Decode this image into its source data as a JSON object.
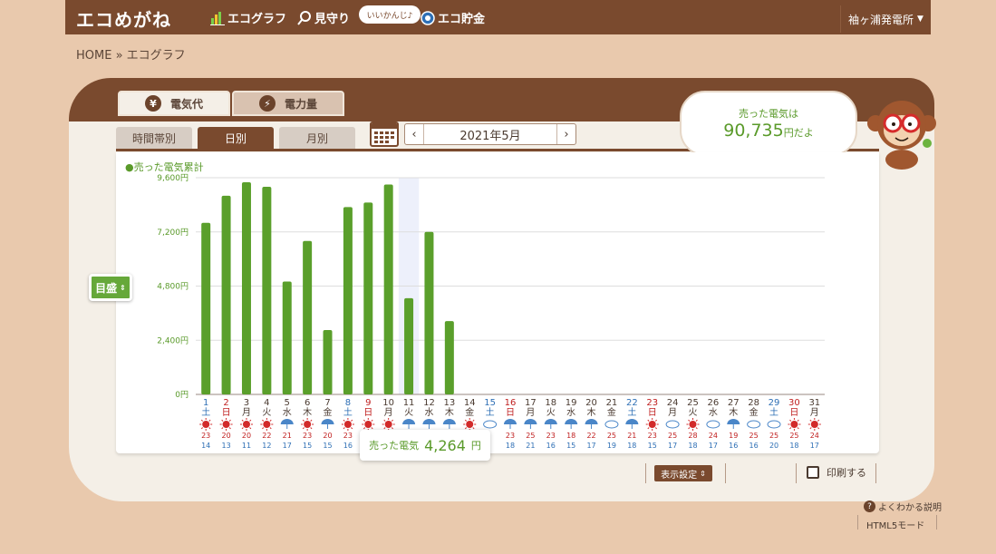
{
  "nav": {
    "logo": "エコめがね",
    "items": [
      {
        "label": "エコグラフ",
        "icon": "bar-chart-icon"
      },
      {
        "label": "見守り",
        "icon": "magnifier-icon"
      },
      {
        "label": "エコ貯金",
        "icon": "coin-icon"
      }
    ],
    "bubble": "いいかんじ♪",
    "site": "袖ヶ浦発電所"
  },
  "breadcrumb": "HOME » エコグラフ",
  "tabs": [
    {
      "label": "電気代",
      "icon": "¥"
    },
    {
      "label": "電力量",
      "icon": "⚡"
    }
  ],
  "subtabs": [
    {
      "label": "時間帯別"
    },
    {
      "label": "日別"
    },
    {
      "label": "月別"
    }
  ],
  "date_nav": {
    "prev": "‹",
    "label": "2021年5月",
    "next": "›"
  },
  "speech": {
    "line1": "売った電気は",
    "value": "90,735",
    "suffix": "円だよ"
  },
  "chart_data": {
    "type": "bar",
    "title": "●売った電気累計",
    "ylim": [
      0,
      9600
    ],
    "yticks": [
      "0円",
      "2,400円",
      "4,800円",
      "7,200円",
      "9,600円"
    ],
    "ytick_values": [
      0,
      2400,
      4800,
      7200,
      9600
    ],
    "days": [
      "1",
      "2",
      "3",
      "4",
      "5",
      "6",
      "7",
      "8",
      "9",
      "10",
      "11",
      "12",
      "13",
      "14",
      "15",
      "16",
      "17",
      "18",
      "19",
      "20",
      "21",
      "22",
      "23",
      "24",
      "25",
      "26",
      "27",
      "28",
      "29",
      "30",
      "31"
    ],
    "weekdays": [
      "土",
      "日",
      "月",
      "火",
      "水",
      "木",
      "金",
      "土",
      "日",
      "月",
      "火",
      "水",
      "木",
      "金",
      "土",
      "日",
      "月",
      "火",
      "水",
      "木",
      "金",
      "土",
      "日",
      "月",
      "火",
      "水",
      "木",
      "金",
      "土",
      "日",
      "月"
    ],
    "values": [
      7600,
      8800,
      9400,
      9200,
      5000,
      6800,
      2850,
      8300,
      8500,
      9300,
      4264,
      7200,
      3250,
      0,
      0,
      0,
      0,
      0,
      0,
      0,
      0,
      0,
      0,
      0,
      0,
      0,
      0,
      0,
      0,
      0,
      0
    ],
    "highlight_index": 10,
    "weather": [
      "sun",
      "sun",
      "sun",
      "sun",
      "rain",
      "sun",
      "rain",
      "sun",
      "sun",
      "sun",
      "rain",
      "rain",
      "rain",
      "sun",
      "cloud",
      "rain",
      "rain",
      "rain",
      "rain",
      "rain",
      "cloud",
      "rain",
      "sun",
      "cloud",
      "sun",
      "cloud",
      "rain",
      "cloud",
      "cloud",
      "sun",
      "sun"
    ],
    "high_temps": [
      23,
      20,
      20,
      22,
      21,
      23,
      20,
      23,
      "",
      "",
      "",
      "",
      "",
      "",
      "",
      23,
      25,
      23,
      18,
      22,
      25,
      21,
      23,
      25,
      28,
      24,
      19,
      25,
      25,
      25,
      24
    ],
    "low_temps": [
      14,
      13,
      11,
      12,
      17,
      15,
      15,
      16,
      "",
      "",
      "",
      "",
      "",
      "",
      "",
      18,
      21,
      16,
      15,
      17,
      19,
      18,
      15,
      17,
      18,
      17,
      16,
      16,
      20,
      18,
      17
    ],
    "colors": {
      "bar": "#5a9f2b",
      "holiday": "#c01f1f",
      "saturday": "#2e6fb5",
      "weekday": "#4a3a30",
      "highlight": "#edf0fb"
    }
  },
  "scale_button": "目盛",
  "tooltip": {
    "label": "売った電気",
    "value": "4,264",
    "unit": "円"
  },
  "controls": {
    "display_settings": "表示設定",
    "print": "印刷する"
  },
  "help": {
    "icon": "?",
    "label": "よくわかる説明"
  },
  "html5_mode": "HTML5モード"
}
